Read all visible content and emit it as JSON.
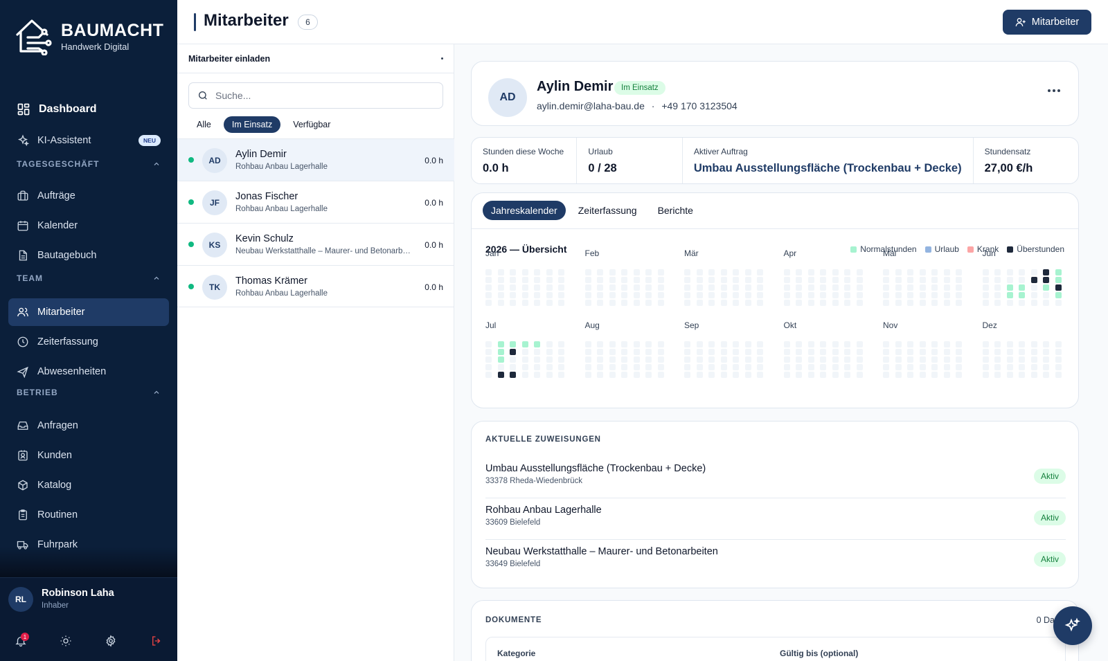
{
  "brand": {
    "name": "BAUMACHT",
    "subtitle": "Handwerk Digital"
  },
  "nav": {
    "dashboard": "Dashboard",
    "ki": "KI-Assistent",
    "ki_badge": "NEU",
    "sections": {
      "tagesgeschaeft": "TAGESGESCHÄFT",
      "team": "TEAM",
      "betrieb": "BETRIEB"
    },
    "auftraege": "Aufträge",
    "kalender": "Kalender",
    "bautagebuch": "Bautagebuch",
    "mitarbeiter": "Mitarbeiter",
    "zeiterfassung": "Zeiterfassung",
    "abwesenheiten": "Abwesenheiten",
    "anfragen": "Anfragen",
    "kunden": "Kunden",
    "katalog": "Katalog",
    "routinen": "Routinen",
    "fuhrpark": "Fuhrpark"
  },
  "user": {
    "initials": "RL",
    "name": "Robinson Laha",
    "role": "Inhaber",
    "notifications": "1"
  },
  "header": {
    "title": "Mitarbeiter",
    "count": "6",
    "add_button": "Mitarbeiter"
  },
  "list": {
    "invite_label": "Mitarbeiter einladen",
    "search_placeholder": "Suche...",
    "filters": [
      "Alle",
      "Im Einsatz",
      "Verfügbar"
    ],
    "employees": [
      {
        "initials": "AD",
        "name": "Aylin Demir",
        "project": "Rohbau Anbau Lagerhalle",
        "hours": "0.0 h"
      },
      {
        "initials": "JF",
        "name": "Jonas Fischer",
        "project": "Rohbau Anbau Lagerhalle",
        "hours": "0.0 h"
      },
      {
        "initials": "KS",
        "name": "Kevin Schulz",
        "project": "Neubau Werkstatthalle – Maurer- und Betonarbeiten",
        "hours": "0.0 h"
      },
      {
        "initials": "TK",
        "name": "Thomas Krämer",
        "project": "Rohbau Anbau Lagerhalle",
        "hours": "0.0 h"
      }
    ]
  },
  "profile": {
    "initials": "AD",
    "name": "Aylin Demir",
    "status": "Im Einsatz",
    "email": "aylin.demir@laha-bau.de",
    "separator": "·",
    "phone": "+49 170 3123504"
  },
  "stats": [
    {
      "label": "Stunden diese Woche",
      "value": "0.0 h"
    },
    {
      "label": "Urlaub",
      "value": "0 / 28"
    },
    {
      "label": "Aktiver Auftrag",
      "value": "Umbau Ausstellungsfläche (Trockenbau + Decke)"
    },
    {
      "label": "Stundensatz",
      "value": "27,00 €/h"
    }
  ],
  "tabs": [
    "Jahreskalender",
    "Zeiterfassung",
    "Berichte"
  ],
  "calendar": {
    "title": "2026 — Übersicht",
    "legend": [
      {
        "label": "Normalstunden",
        "color": "#a7f3d0"
      },
      {
        "label": "Urlaub",
        "color": "#93b4e0"
      },
      {
        "label": "Krank",
        "color": "#fca5a5"
      },
      {
        "label": "Überstunden",
        "color": "#1e293b"
      }
    ],
    "empty_color": "#f1f5f9",
    "months": [
      "Jan",
      "Feb",
      "Mär",
      "Apr",
      "Mai",
      "Jun",
      "Jul",
      "Aug",
      "Sep",
      "Okt",
      "Nov",
      "Dez"
    ],
    "marked_days": {
      "Jun": {
        "normal": [
          6,
          13,
          16,
          17,
          19,
          23,
          24,
          27
        ],
        "overtime": [
          5,
          11,
          12,
          20
        ]
      },
      "Jul": {
        "normal": [
          1,
          2,
          3,
          4,
          8,
          15
        ],
        "overtime": [
          9,
          29,
          30,
          36
        ]
      }
    }
  },
  "assignments": {
    "heading": "AKTUELLE ZUWEISUNGEN",
    "items": [
      {
        "title": "Umbau Ausstellungsfläche (Trockenbau + Decke)",
        "location": "33378 Rheda-Wiedenbrück",
        "status": "Aktiv"
      },
      {
        "title": "Rohbau Anbau Lagerhalle",
        "location": "33609 Bielefeld",
        "status": "Aktiv"
      },
      {
        "title": "Neubau Werkstatthalle – Maurer- und Betonarbeiten",
        "location": "33649 Bielefeld",
        "status": "Aktiv"
      }
    ]
  },
  "documents": {
    "heading": "DOKUMENTE",
    "count": "0 Da",
    "columns": [
      "Kategorie",
      "Gültig bis (optional)"
    ]
  },
  "icons": {
    "brand": "house-circuit-icon",
    "fab": "sparkle-icon"
  },
  "colors": {
    "sidebar": "#0b1f3a",
    "primary": "#1f3b66",
    "success": "#10b981"
  }
}
